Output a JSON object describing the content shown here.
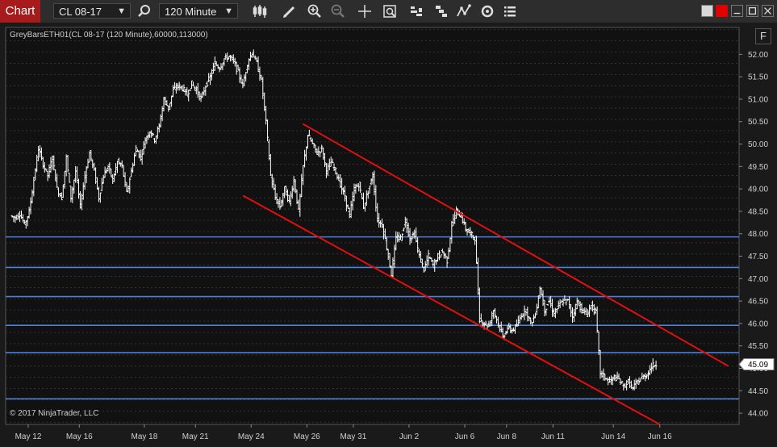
{
  "toolbar": {
    "tab_label": "Chart",
    "instrument": "CL 08-17",
    "interval": "120 Minute",
    "icons": [
      "search-icon",
      "bar-type-icon",
      "draw-icon",
      "zoom-in-icon",
      "zoom-out-icon",
      "crosshair-icon",
      "data-box-icon",
      "indicators-icon",
      "strategies-icon",
      "chart-trader-icon",
      "reload-icon",
      "properties-icon"
    ]
  },
  "window": {
    "colors": {
      "red": "#e00000",
      "white": "#e0e0e0"
    }
  },
  "chart_data": {
    "type": "bar",
    "title": "GreyBarsETH01(CL 08-17 (120 Minute),60000,113000)",
    "copyright": "© 2017 NinjaTrader, LLC",
    "ylim": [
      43.75,
      52.6
    ],
    "y_ticks": [
      44.0,
      44.5,
      45.0,
      45.5,
      46.0,
      46.5,
      47.0,
      47.5,
      48.0,
      48.5,
      49.0,
      49.5,
      50.0,
      50.5,
      51.0,
      51.5,
      52.0
    ],
    "x_tick_labels": [
      "May 12",
      "May 16",
      "May 18",
      "May 21",
      "May 24",
      "May 26",
      "May 31",
      "Jun 2",
      "Jun 6",
      "Jun 8",
      "Jun 11",
      "Jun 14",
      "Jun 16"
    ],
    "last_price": "45.09",
    "colors": {
      "bars": "#ffffff",
      "horizontal_lines": "#4f7fd6",
      "channel": "#e01010",
      "price_marker": "#ffffff"
    },
    "horizontal_lines": [
      47.93,
      47.25,
      46.6,
      45.96,
      45.35,
      44.32
    ],
    "channel_lines": [
      {
        "from": [
          "May 26",
          50.45
        ],
        "to": [
          "Jun 16",
          45.05
        ]
      },
      {
        "from": [
          "May 24",
          48.85
        ],
        "to": [
          "Jun 16",
          43.75
        ]
      }
    ],
    "price_path": [
      [
        "May 12",
        48.4
      ],
      [
        null,
        48.35
      ],
      [
        null,
        48.45
      ],
      [
        null,
        48.2
      ],
      [
        null,
        48.5
      ],
      [
        null,
        49.2
      ],
      [
        null,
        49.9
      ],
      [
        null,
        49.55
      ],
      [
        null,
        49.3
      ],
      [
        null,
        49.7
      ],
      [
        null,
        49.0
      ],
      [
        "May 16",
        48.8
      ],
      [
        null,
        49.7
      ],
      [
        null,
        48.8
      ],
      [
        null,
        49.4
      ],
      [
        null,
        48.6
      ],
      [
        null,
        49.3
      ],
      [
        null,
        49.8
      ],
      [
        null,
        49.4
      ],
      [
        null,
        48.8
      ],
      [
        null,
        49.3
      ],
      [
        null,
        49.5
      ],
      [
        null,
        49.2
      ],
      [
        null,
        49.6
      ],
      [
        null,
        49.5
      ],
      [
        "May 18",
        48.9
      ],
      [
        null,
        49.4
      ],
      [
        null,
        49.9
      ],
      [
        null,
        49.7
      ],
      [
        null,
        50.1
      ],
      [
        null,
        50.3
      ],
      [
        null,
        50.1
      ],
      [
        null,
        50.4
      ],
      [
        null,
        51.0
      ],
      [
        null,
        50.8
      ],
      [
        null,
        51.2
      ],
      [
        "May 21",
        51.3
      ],
      [
        null,
        51.25
      ],
      [
        null,
        51.1
      ],
      [
        null,
        51.35
      ],
      [
        null,
        51.2
      ],
      [
        null,
        51.0
      ],
      [
        null,
        51.3
      ],
      [
        null,
        51.5
      ],
      [
        null,
        51.8
      ],
      [
        null,
        51.7
      ],
      [
        null,
        51.9
      ],
      [
        null,
        51.95
      ],
      [
        "May 24",
        51.85
      ],
      [
        null,
        51.6
      ],
      [
        null,
        51.3
      ],
      [
        null,
        51.8
      ],
      [
        null,
        52.05
      ],
      [
        null,
        51.8
      ],
      [
        null,
        51.4
      ],
      [
        null,
        50.5
      ],
      [
        null,
        49.3
      ],
      [
        null,
        48.8
      ],
      [
        null,
        48.6
      ],
      [
        null,
        49.0
      ],
      [
        "May 26",
        48.7
      ],
      [
        null,
        49.2
      ],
      [
        null,
        48.5
      ],
      [
        null,
        49.5
      ],
      [
        null,
        50.2
      ],
      [
        null,
        50.0
      ],
      [
        null,
        49.8
      ],
      [
        null,
        49.9
      ],
      [
        null,
        49.4
      ],
      [
        null,
        49.6
      ],
      [
        "May 31",
        49.4
      ],
      [
        null,
        49.1
      ],
      [
        null,
        48.8
      ],
      [
        null,
        48.4
      ],
      [
        null,
        49.0
      ],
      [
        null,
        49.1
      ],
      [
        null,
        48.6
      ],
      [
        null,
        48.95
      ],
      [
        null,
        49.3
      ],
      [
        null,
        48.3
      ],
      [
        null,
        48.2
      ],
      [
        null,
        47.7
      ],
      [
        "Jun 2",
        47.1
      ],
      [
        null,
        47.9
      ],
      [
        null,
        47.9
      ],
      [
        null,
        48.3
      ],
      [
        null,
        47.9
      ],
      [
        null,
        48.0
      ],
      [
        null,
        47.5
      ],
      [
        null,
        47.2
      ],
      [
        null,
        47.5
      ],
      [
        null,
        47.3
      ],
      [
        null,
        47.5
      ],
      [
        null,
        47.6
      ],
      [
        "Jun 6",
        47.4
      ],
      [
        null,
        48.2
      ],
      [
        null,
        48.5
      ],
      [
        null,
        48.4
      ],
      [
        null,
        48.1
      ],
      [
        null,
        48.0
      ],
      [
        null,
        47.9
      ],
      [
        null,
        46.1
      ],
      [
        null,
        46.0
      ],
      [
        "Jun 8",
        45.95
      ],
      [
        null,
        46.3
      ],
      [
        null,
        46.0
      ],
      [
        null,
        45.7
      ],
      [
        null,
        45.9
      ],
      [
        null,
        45.85
      ],
      [
        null,
        45.95
      ],
      [
        null,
        46.2
      ],
      [
        null,
        46.3
      ],
      [
        null,
        46.0
      ],
      [
        "Jun 11",
        46.2
      ],
      [
        null,
        46.8
      ],
      [
        null,
        46.3
      ],
      [
        null,
        46.5
      ],
      [
        null,
        46.2
      ],
      [
        null,
        46.4
      ],
      [
        null,
        46.5
      ],
      [
        null,
        46.5
      ],
      [
        null,
        46.15
      ],
      [
        null,
        46.5
      ],
      [
        null,
        46.3
      ],
      [
        null,
        46.2
      ],
      [
        null,
        46.4
      ],
      [
        "Jun 14",
        46.25
      ],
      [
        null,
        44.9
      ],
      [
        null,
        44.8
      ],
      [
        null,
        44.7
      ],
      [
        null,
        44.8
      ],
      [
        null,
        44.75
      ],
      [
        null,
        44.6
      ],
      [
        null,
        44.7
      ],
      [
        null,
        44.55
      ],
      [
        null,
        44.7
      ],
      [
        "Jun 16",
        44.8
      ],
      [
        null,
        44.85
      ],
      [
        null,
        45.05
      ],
      [
        null,
        45.09
      ]
    ]
  }
}
